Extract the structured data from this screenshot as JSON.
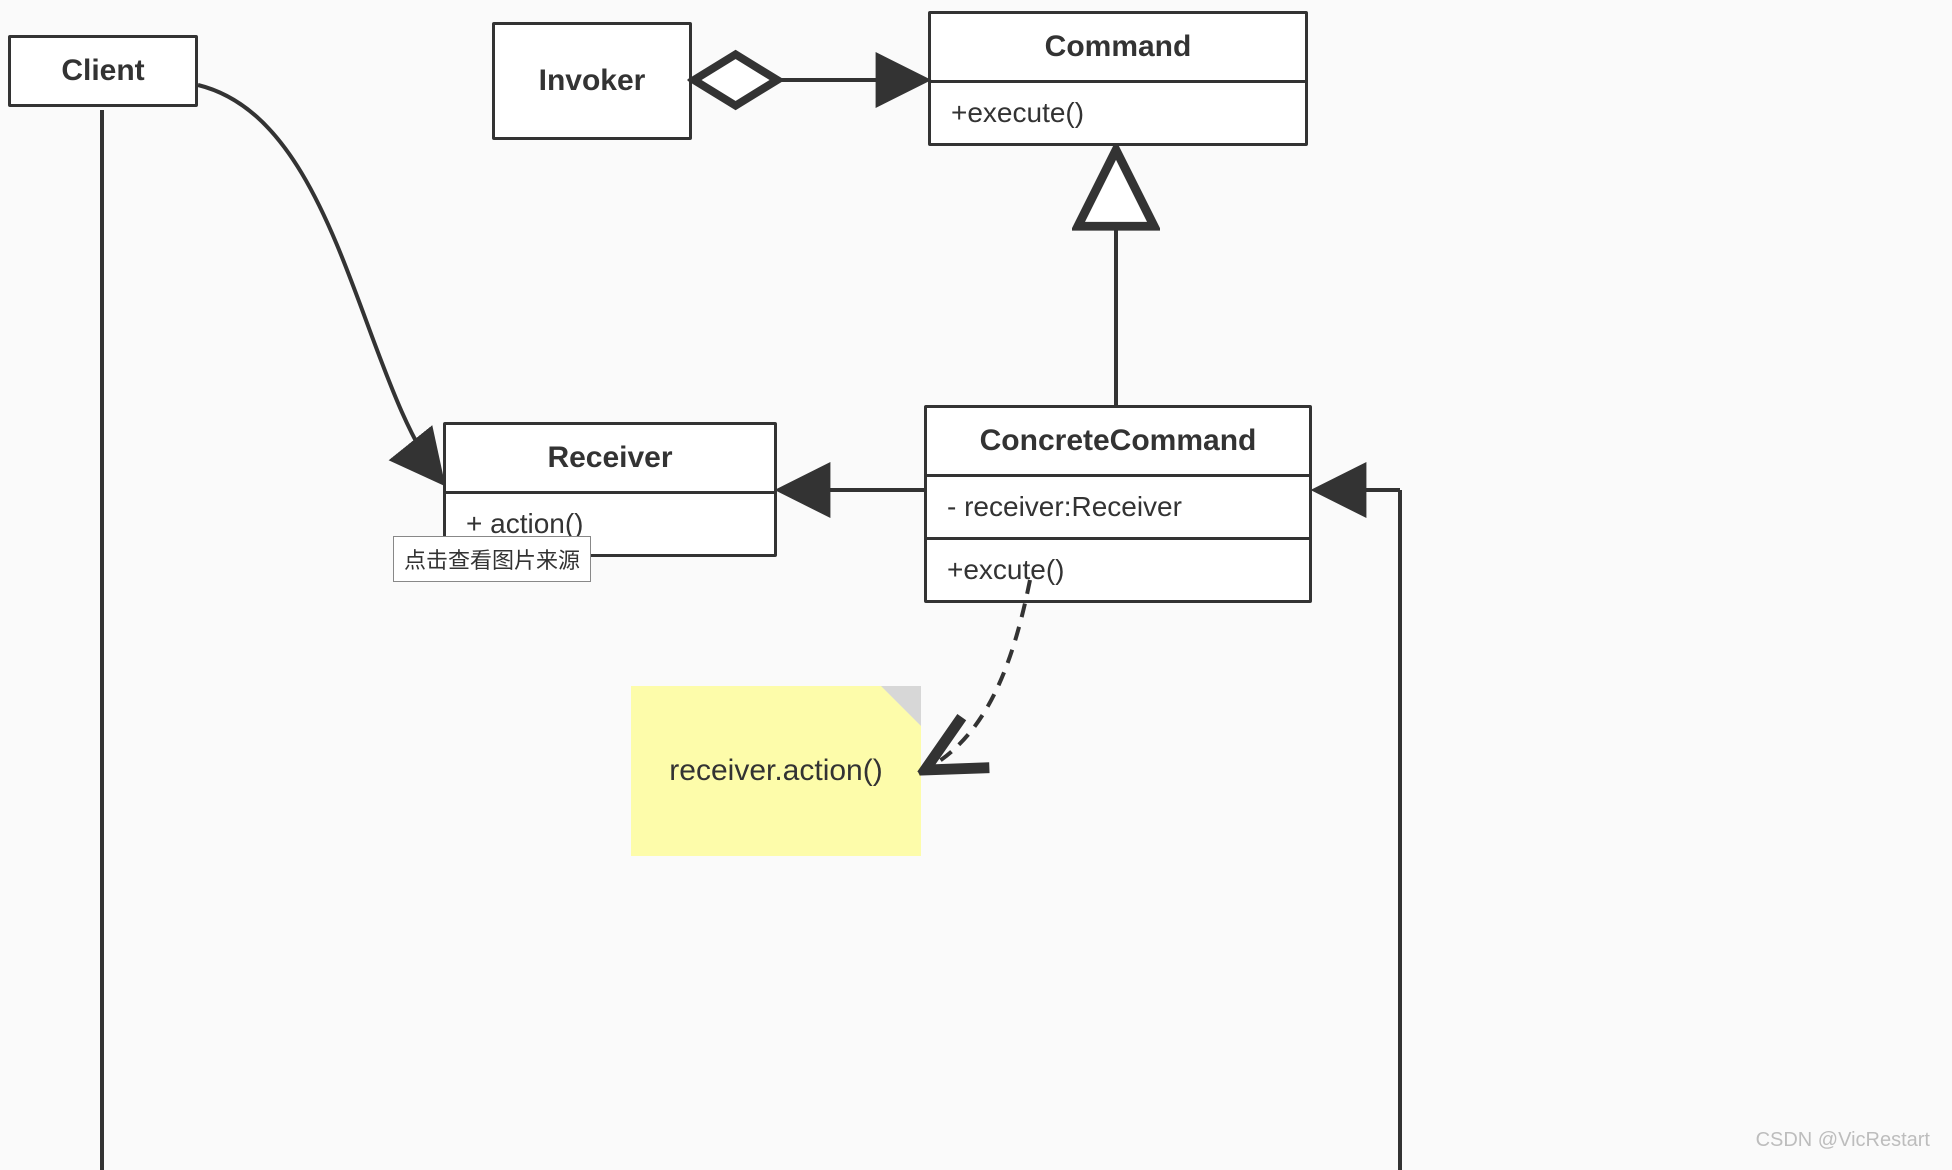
{
  "classes": {
    "client": {
      "name": "Client"
    },
    "invoker": {
      "name": "Invoker"
    },
    "command": {
      "name": "Command",
      "method": "+execute()"
    },
    "receiver": {
      "name": "Receiver",
      "method": "+ action()"
    },
    "concreteCommand": {
      "name": "ConcreteCommand",
      "attr": "- receiver:Receiver",
      "method": "+excute()"
    }
  },
  "note": {
    "text": "receiver.action()"
  },
  "tooltip": {
    "text": "点击查看图片来源"
  },
  "watermark": {
    "text": "CSDN @VicRestart"
  }
}
